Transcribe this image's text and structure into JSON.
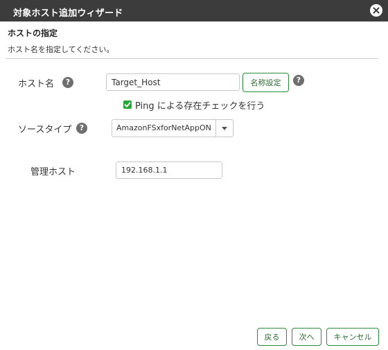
{
  "window": {
    "title": "対象ホスト追加ウィザード"
  },
  "section": {
    "title": "ホストの指定",
    "description": "ホスト名を指定してください。"
  },
  "form": {
    "host_name": {
      "label": "ホスト名",
      "value": "Target_Host",
      "button_label": "名称設定"
    },
    "ping_check": {
      "label": "Ping による存在チェックを行う",
      "checked": true
    },
    "source_type": {
      "label": "ソースタイプ",
      "selected": "AmazonFSxforNetAppON"
    },
    "management_host": {
      "label": "管理ホスト",
      "value": "192.168.1.1"
    }
  },
  "footer": {
    "back_label": "戻る",
    "next_label": "次へ",
    "cancel_label": "キャンセル"
  },
  "icons": {
    "help": "question-circle-icon",
    "close": "close-icon",
    "check": "check-icon",
    "dropdown": "caret-down-icon"
  },
  "colors": {
    "titlebar": "#3c3c3c",
    "accent_green": "#2e8b3a",
    "checkbox_green": "#27a83b"
  }
}
